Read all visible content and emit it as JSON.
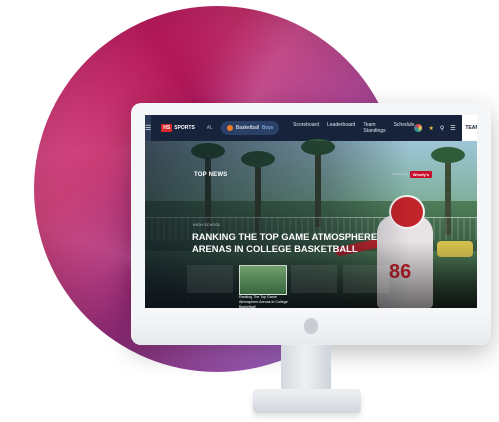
{
  "nav": {
    "brand_badge": "HS",
    "brand_name": "SPORTS",
    "state": "AL",
    "sport": "Basketball",
    "gender": "Boys",
    "links": [
      "Scoreboard",
      "Leaderboard",
      "Team Standings",
      "Schedule"
    ],
    "teams_label": "TEAMS ›"
  },
  "hero": {
    "section_title": "TOP NEWS",
    "presenter_tag": "Presented by",
    "presenter_logo": "Wendy's",
    "headline_tag": "HIGH SCHOOL",
    "headline": "RANKING THE TOP GAME ATMOSPHERE ARENAS IN COLLEGE BASKETBALL",
    "thumbnails": [
      {
        "caption": "...",
        "active": false
      },
      {
        "caption": "Ranking The Top Game Atmosphere Arenas In College Basketball",
        "active": true
      },
      {
        "caption": "...",
        "active": false
      },
      {
        "caption": "...",
        "active": false
      }
    ]
  },
  "colors": {
    "nav_bg": "#16233a",
    "accent_red": "#d62a2a",
    "sphere_pink": "#d81668",
    "sphere_purple": "#7d52d2"
  }
}
